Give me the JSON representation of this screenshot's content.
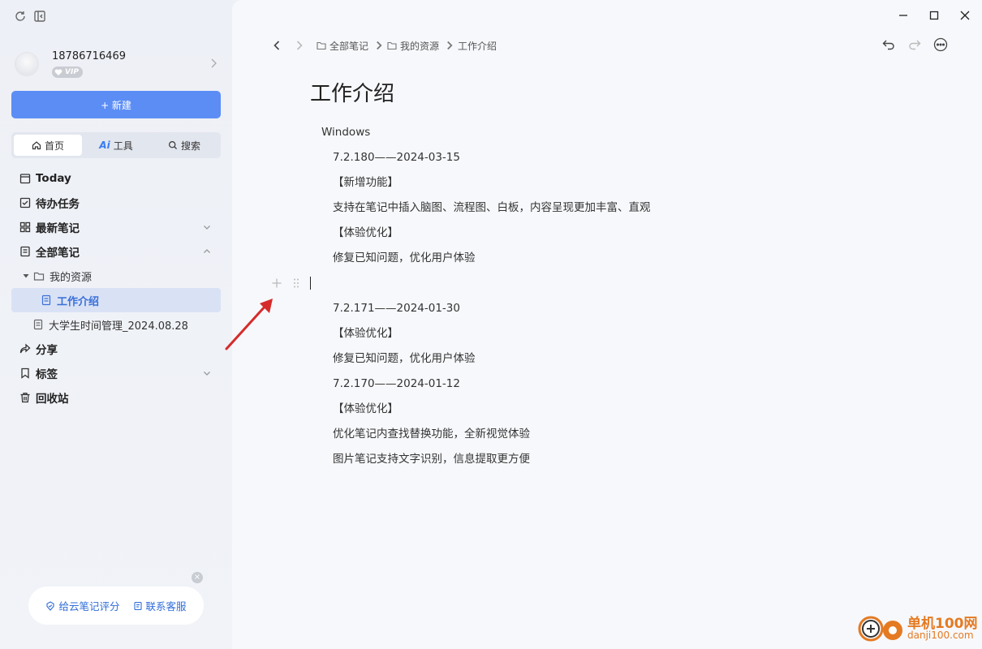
{
  "sidebar": {
    "user": {
      "phone": "18786716469",
      "badge": "VIP"
    },
    "new_button": "+ 新建",
    "tabs": [
      {
        "label": "首页",
        "active": true
      },
      {
        "label": "工具",
        "prefix": "Ai",
        "active": false
      },
      {
        "label": "搜索",
        "active": false
      }
    ],
    "nav": {
      "today": "Today",
      "todo": "待办任务",
      "recent": "最新笔记",
      "all": "全部笔记",
      "folder": "我的资源",
      "selected_note": "工作介绍",
      "other_note": "大学生时间管理_2024.08.28",
      "share": "分享",
      "tags": "标签",
      "trash": "回收站"
    },
    "feedback": {
      "rate": "给云笔记评分",
      "support": "联系客服",
      "close": "×"
    }
  },
  "header": {
    "breadcrumb": [
      "全部笔记",
      "我的资源",
      "工作介绍"
    ]
  },
  "document": {
    "title": "工作介绍",
    "lines": [
      "Windows",
      "7.2.180——2024-03-15",
      "【新增功能】",
      "支持在笔记中插入脑图、流程图、白板，内容呈现更加丰富、直观",
      "【体验优化】",
      "修复已知问题，优化用户体验",
      "7.2.171——2024-01-30",
      "【体验优化】",
      "修复已知问题，优化用户体验",
      "7.2.170——2024-01-12",
      "【体验优化】",
      "优化笔记内查找替换功能，全新视觉体验",
      "图片笔记支持文字识别，信息提取更方便"
    ]
  },
  "watermark": {
    "brand": "单机100网",
    "url": "danji100.com"
  },
  "colors": {
    "accent": "#5b8df5",
    "selected_bg": "#d9e2f5",
    "selected_text": "#3a6fd8",
    "annotation_arrow": "#d62b2b"
  }
}
